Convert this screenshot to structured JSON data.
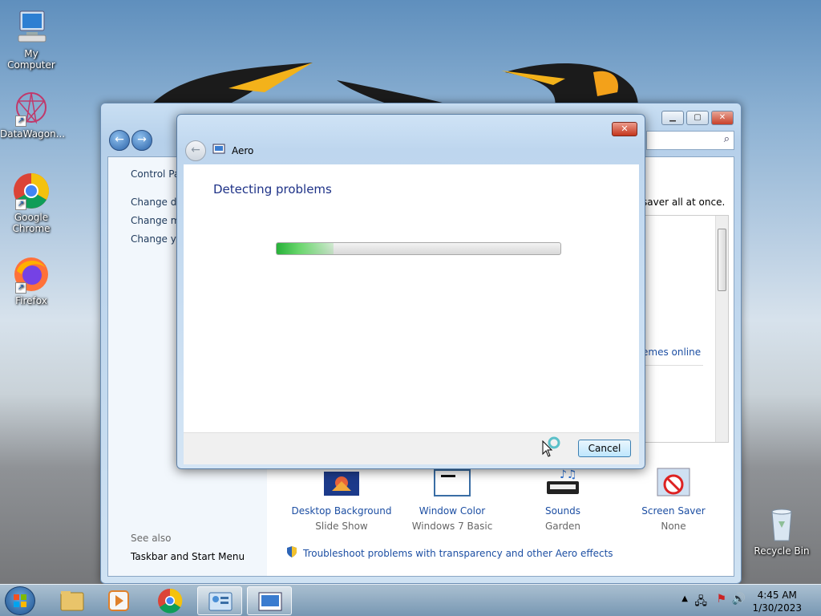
{
  "desktop": {
    "icons": [
      {
        "label": "My Computer"
      },
      {
        "label": "DataWagon..."
      },
      {
        "label": "Google Chrome"
      },
      {
        "label": "Firefox"
      },
      {
        "label": "Recycle Bin"
      }
    ]
  },
  "control_panel": {
    "nav_links": [
      "Control Par",
      "Change de",
      "Change mo",
      "Change yo"
    ],
    "see_also_title": "See also",
    "see_also_link": "Taskbar and Start Menu",
    "header_text": "saver all at once.",
    "themes_link": "emes online",
    "items": [
      {
        "title": "Desktop Background",
        "subtitle": "Slide Show"
      },
      {
        "title": "Window Color",
        "subtitle": "Windows 7 Basic"
      },
      {
        "title": "Sounds",
        "subtitle": "Garden"
      },
      {
        "title": "Screen Saver",
        "subtitle": "None"
      }
    ],
    "troubleshoot_link": "Troubleshoot problems with transparency and other Aero effects"
  },
  "dialog": {
    "title": "Aero",
    "heading": "Detecting problems",
    "progress": 0.2,
    "cancel_label": "Cancel",
    "close_glyph": "✕"
  },
  "taskbar": {
    "time": "4:45 AM",
    "date": "1/30/2023"
  },
  "colors": {
    "link": "#1d4fa3",
    "heading": "#1e3287",
    "progress_green": "#27b139"
  }
}
